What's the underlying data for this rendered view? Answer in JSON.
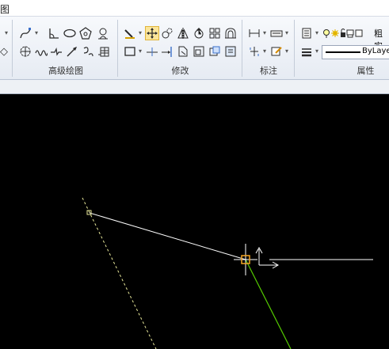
{
  "titlebar": {
    "tab_text": "图"
  },
  "ribbon": {
    "groups": {
      "advanced_draw": {
        "label": "高级绘图"
      },
      "modify": {
        "label": "修改"
      },
      "annotate": {
        "label": "标注"
      },
      "properties": {
        "label": "属性"
      }
    },
    "layer_name_fragment": "粗实",
    "lineweight_value": "ByLayer"
  },
  "icons": {
    "spline": "spline-icon",
    "angle_dim": "angle-icon",
    "ellipse": "ellipse-icon",
    "polygon": "polygon-icon",
    "helix": "helix-icon",
    "revcloud": "revision-cloud-icon",
    "wave": "wave-line-icon",
    "arrow": "arrow-icon",
    "tag": "tag-icon",
    "move": "move-icon",
    "copy": "copy-icon",
    "mirror": "mirror-icon",
    "rotate": "rotate-icon",
    "array": "array-icon",
    "offset": "offset-icon"
  },
  "colors": {
    "canvas_bg": "#000000",
    "ribbon_bg": "#e6ebf3",
    "line_white": "#ffffff",
    "line_green": "#55cc00",
    "snap_marker": "#f5a623",
    "dashed_yellow": "#e8e89a"
  }
}
